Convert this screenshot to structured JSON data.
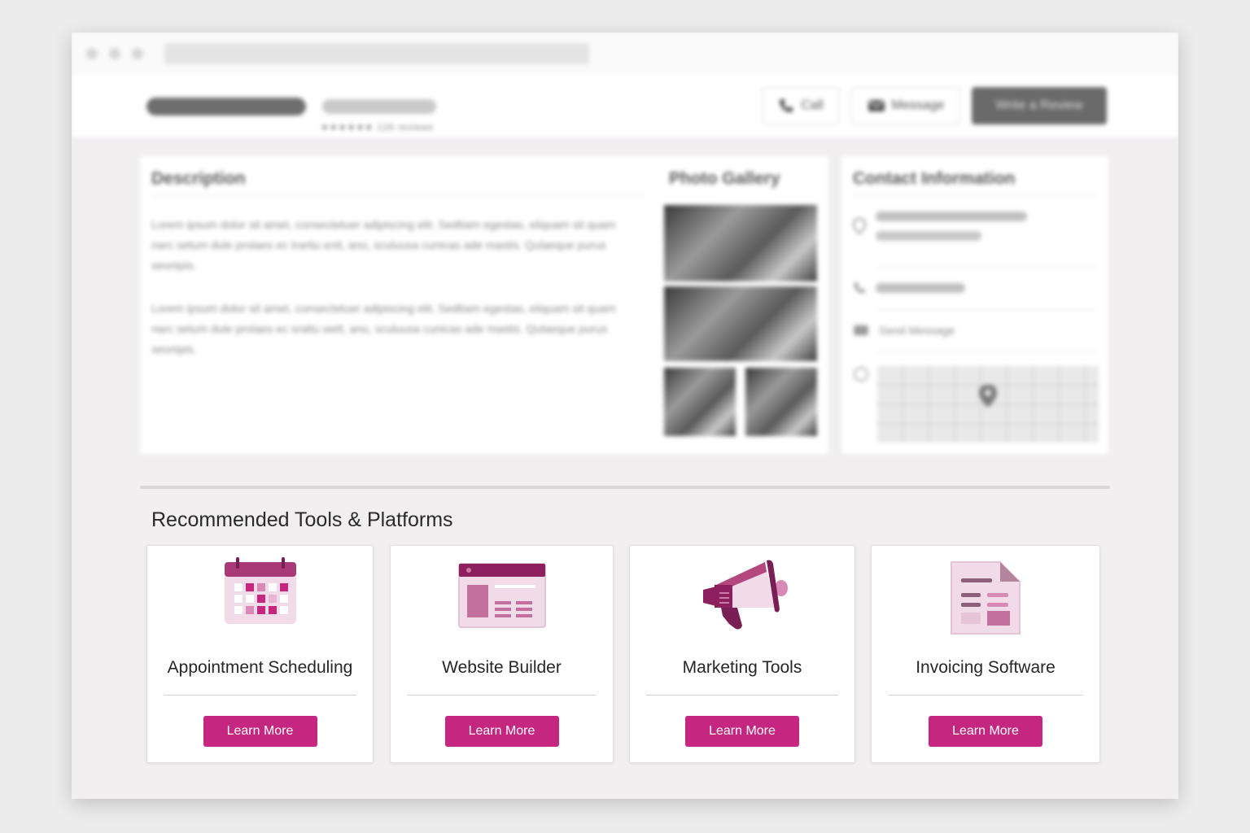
{
  "header": {
    "rating_text": "★★★★★★  126 reviews",
    "call_label": "Call",
    "message_label": "Message",
    "review_label": "Write a Review"
  },
  "description": {
    "title": "Description",
    "paragraphs": [
      "Lorem ipsum dolor sit amet, consectetuer adipiscing elit. Sedtiam egestas, eliquam sit quam narc setum dule prolaes ec trartiu enit, ano, sculuusa cunicas ade mastis. Qulaeque purus seonipis.",
      "Lorem ipsum dolor sit amet, consectetuer adipiscing elit. Sedtiam egestas, eliquam sit quam narc setum dule prolaes ec srattu welt, ano, sculuusa cunicas ade mastis. Qulaeque purus seonipis."
    ]
  },
  "gallery": {
    "title": "Photo Gallery"
  },
  "contact": {
    "title": "Contact Information",
    "send_message": "Send Message"
  },
  "recommended": {
    "title": "Recommended Tools & Platforms",
    "cards": [
      {
        "label": "Appointment Scheduling",
        "button": "Learn More",
        "icon": "calendar-icon"
      },
      {
        "label": "Website Builder",
        "button": "Learn More",
        "icon": "website-layout-icon"
      },
      {
        "label": "Marketing Tools",
        "button": "Learn More",
        "icon": "megaphone-icon"
      },
      {
        "label": "Invoicing Software",
        "button": "Learn More",
        "icon": "invoice-document-icon"
      }
    ]
  },
  "colors": {
    "accent": "#c42680",
    "accent_dark": "#8e1f5e",
    "accent_light": "#f2dbe8",
    "page_bg": "#ececec"
  }
}
